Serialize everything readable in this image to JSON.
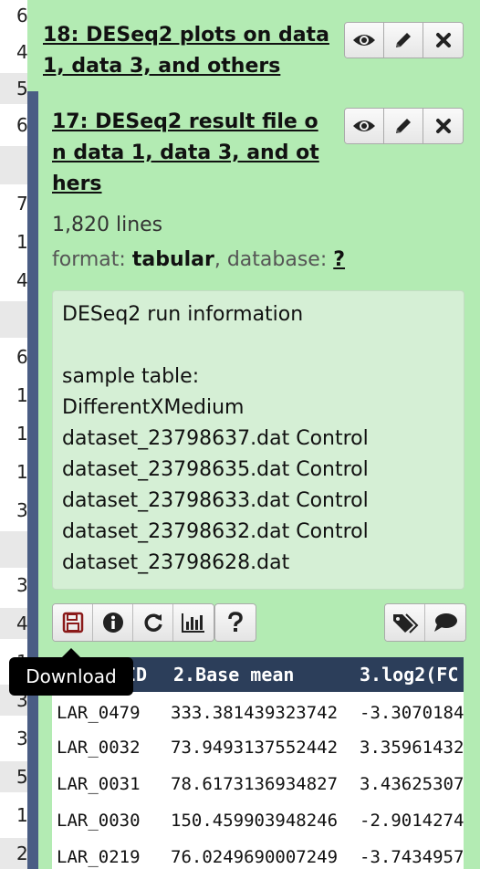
{
  "gutter": [
    "6",
    "4",
    "5",
    "6",
    "",
    "7",
    "1",
    "4",
    "",
    "6",
    "1",
    "1",
    "1",
    "3",
    "",
    "3",
    "4",
    "1",
    "3",
    "3",
    "5",
    "1",
    "2"
  ],
  "item18": {
    "title_line1": "18: DESeq2 plots on data",
    "title_line2": "1, data 3, and others"
  },
  "item17": {
    "title_line1": "17: DESeq2 result file o",
    "title_line2": "n data 1, data 3, and ot",
    "title_line3": "hers",
    "lines": "1,820 lines",
    "format_label": "format:",
    "format_value": "tabular",
    "database_label": ", database:",
    "database_value": "?",
    "info_lines": [
      "DESeq2 run information",
      "",
      "sample table:",
      "DifferentXMedium",
      "dataset_23798637.dat Control",
      "dataset_23798635.dat Control",
      "dataset_23798633.dat Control",
      "dataset_23798632.dat Control",
      "dataset_23798628.dat"
    ]
  },
  "icons": {
    "eye": "eye-icon",
    "edit": "pencil-icon",
    "delete": "close-icon",
    "download": "floppy-disk-icon",
    "info": "info-icon",
    "rerun": "refresh-icon",
    "visualize": "bar-chart-icon",
    "help": "question-icon",
    "tags": "tags-icon",
    "annotate": "comment-icon"
  },
  "tooltip": "Download",
  "table": {
    "headers": [
      "ID",
      "2.Base mean",
      "3.log2(FC"
    ],
    "rows": [
      [
        "LAR_0479",
        "333.381439323742",
        "-3.3070184"
      ],
      [
        "LAR_0032",
        "73.9493137552442",
        "3.35961432"
      ],
      [
        "LAR_0031",
        "78.6173136934827",
        "3.43625307"
      ],
      [
        "LAR_0030",
        "150.459903948246",
        "-2.9014274"
      ],
      [
        "LAR_0219",
        "76.0249690007249",
        "-3.7434957"
      ]
    ]
  },
  "colors": {
    "item_bg": "#b3ebb3",
    "info_bg": "#d5efd5",
    "table_header": "#2c3e5a",
    "state_bar": "#4a5d84",
    "download_icon": "#8b1a1a"
  }
}
